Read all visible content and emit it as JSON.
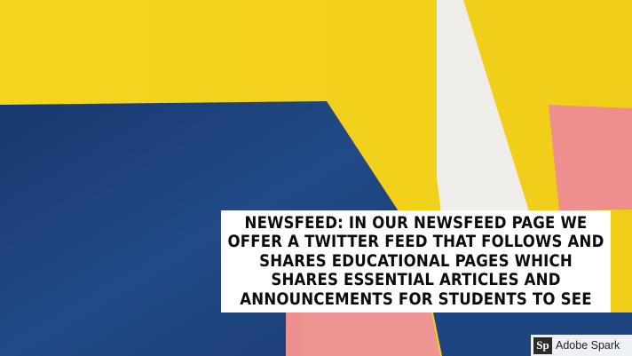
{
  "caption": {
    "text": "Newsfeed: In our newsfeed page we offer a twitter feed that follows and shares educational pages which shares essential articles and announcements for students to see"
  },
  "badge": {
    "logo_text": "Sp",
    "label": "Adobe Spark"
  },
  "colors": {
    "yellow": "#f2d21c",
    "navy": "#1d3f78",
    "white": "#eeedea",
    "pink": "#ee8e8e",
    "caption_bg": "#ffffff",
    "caption_text": "#0b0b0b"
  }
}
